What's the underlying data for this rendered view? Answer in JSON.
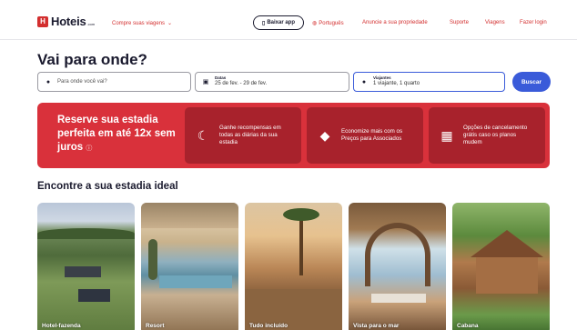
{
  "header": {
    "logo_text": "Hoteis",
    "logo_suffix": ".com",
    "logo_mark": "H",
    "trips_label": "Compre suas viagens",
    "app_button": "Baixar app",
    "language": "Português",
    "links": [
      "Anuncie a sua propriedade",
      "Suporte",
      "Viagens",
      "Fazer login"
    ]
  },
  "page_title": "Vai para onde?",
  "search": {
    "destination_placeholder": "Para onde você vai?",
    "dates_label": "Datas",
    "dates_value": "25 de fev. - 29 de fev.",
    "travelers_label": "Viajantes",
    "travelers_value": "1 viajante, 1 quarto",
    "submit_label": "Buscar"
  },
  "promo": {
    "headline": "Reserve sua estadia perfeita em até 12x sem juros",
    "cards": [
      {
        "icon": "moon-icon",
        "text": "Ganhe recompensas em todas as diárias da sua estadia"
      },
      {
        "icon": "tag-icon",
        "text": "Economize mais com os Preços para Associados"
      },
      {
        "icon": "calendar-icon",
        "text": "Opções de cancelamento grátis caso os planos mudem"
      }
    ],
    "color": "#d9313b"
  },
  "section_title": "Encontre a sua estadia ideal",
  "stay_types": [
    {
      "label": "Hotel-fazenda"
    },
    {
      "label": "Resort"
    },
    {
      "label": "Tudo incluído"
    },
    {
      "label": "Vista para o mar"
    },
    {
      "label": "Cabana"
    }
  ],
  "colors": {
    "brand": "#d32f2f",
    "accent": "#3a5bd9"
  }
}
